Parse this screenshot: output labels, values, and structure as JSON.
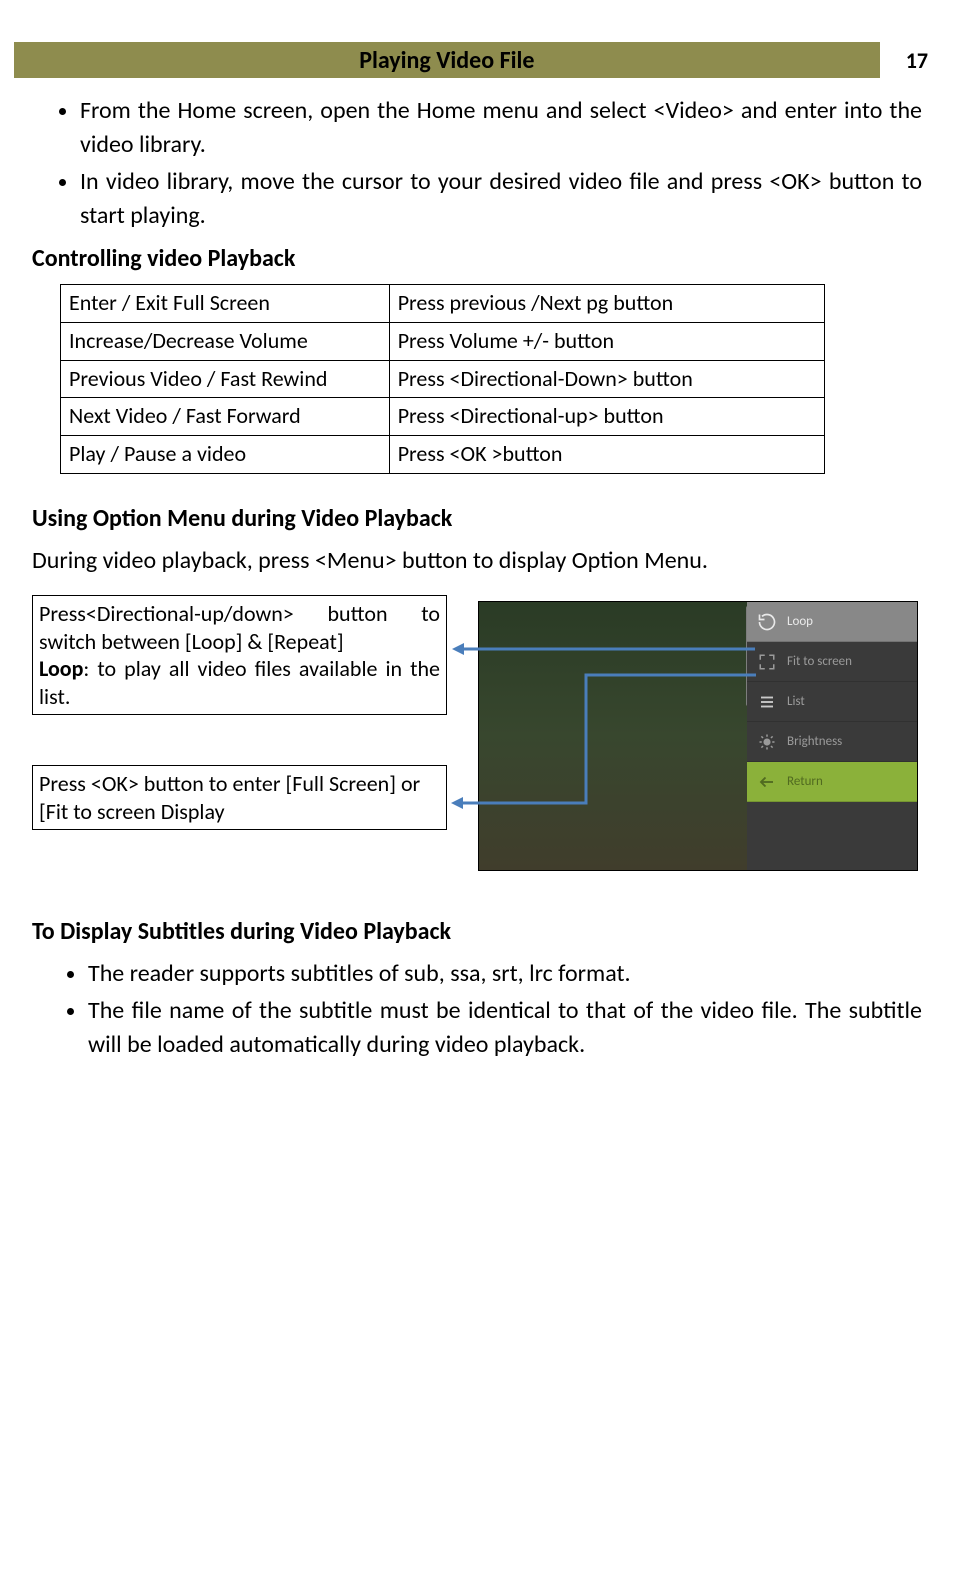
{
  "header": {
    "title": "Playing Video File",
    "page_number": "17"
  },
  "intro_list": [
    "From the Home screen, open the Home menu and select <Video> and enter into the video library.",
    "In video library, move the cursor to your desired video file and press <OK>  button to start playing."
  ],
  "sub1": "Controlling video Playback",
  "table": [
    [
      "Enter / Exit Full Screen",
      "Press  previous /Next pg button"
    ],
    [
      "Increase/Decrease Volume",
      "Press Volume +/- button"
    ],
    [
      "Previous Video / Fast Rewind",
      "Press <Directional-Down> button"
    ],
    [
      "Next Video / Fast Forward",
      "Press <Directional-up> button"
    ],
    [
      "Play / Pause a video",
      "Press <OK >button"
    ]
  ],
  "sub2": "Using Option Menu during Video Playback",
  "para2": "During video playback, press <Menu> button to display Option Menu.",
  "callout1_a": "Press<Directional-up/down> button to switch between [Loop] & [Repeat]",
  "callout1_b_label": "Loop",
  "callout1_b_rest": ": to play all video files available in the list.",
  "callout2": "Press <OK> button to enter [Full Screen] or [Fit to screen Display",
  "menu": {
    "loop": "Loop",
    "fit": "Fit to screen",
    "list": "List",
    "brightness": "Brightness",
    "return": "Return"
  },
  "sub3": "To Display Subtitles during Video Playback",
  "sub3_list": [
    "The reader supports subtitles of sub, ssa, srt, lrc format.",
    "The file name of the subtitle must be identical to that of the video file. The subtitle will be loaded automatically during video playback."
  ]
}
